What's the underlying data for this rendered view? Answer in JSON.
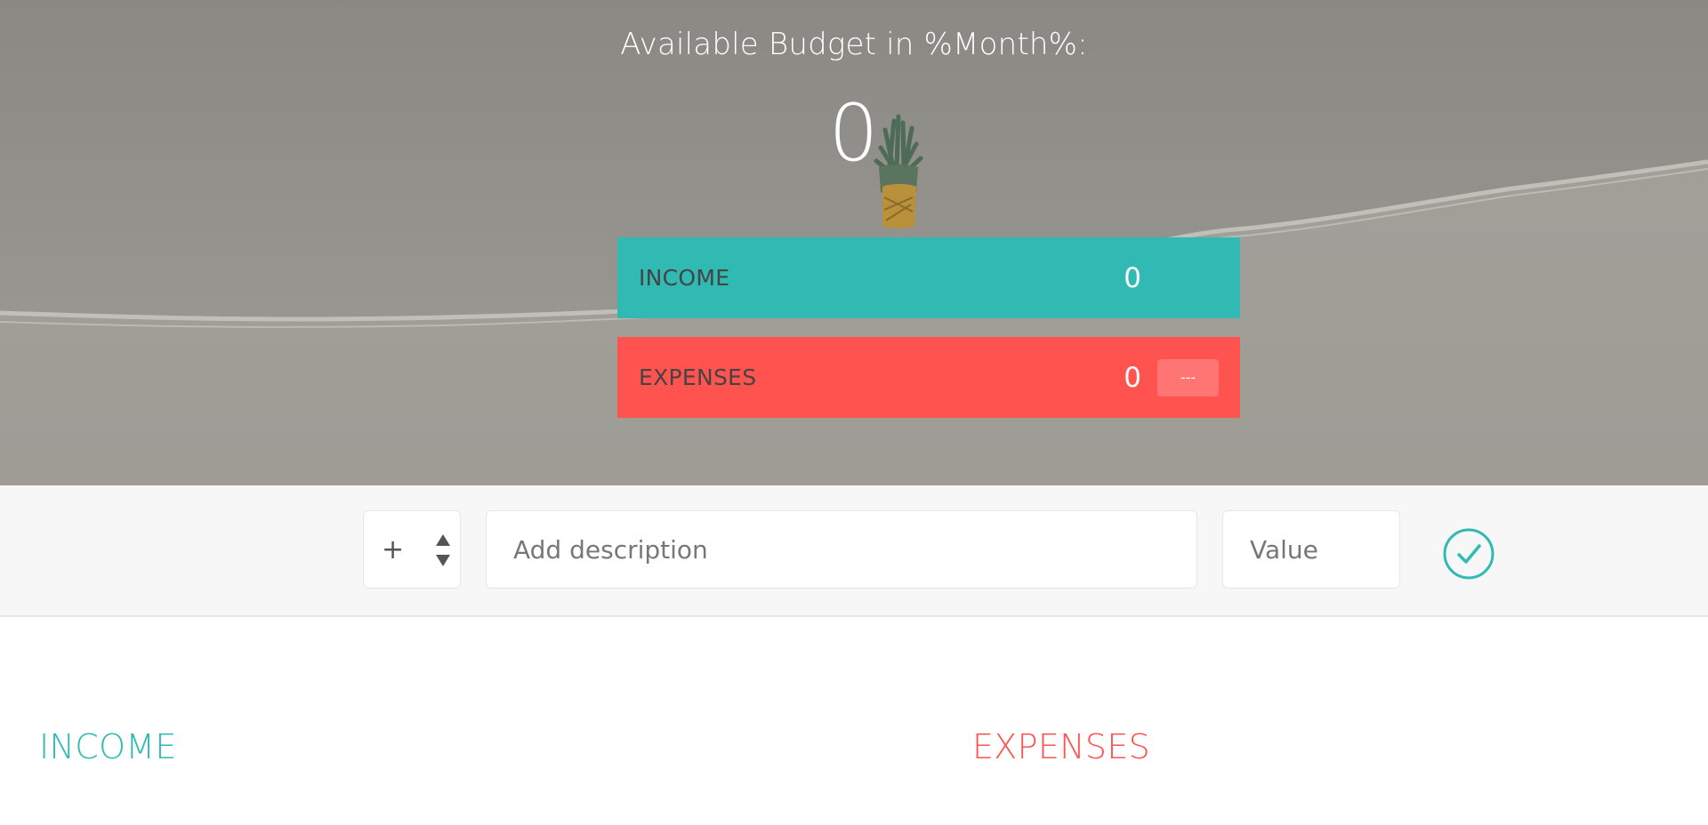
{
  "budget": {
    "title": "Available Budget in %Month%:",
    "value": "0"
  },
  "summary": {
    "income": {
      "label": "INCOME",
      "value": "0"
    },
    "expenses": {
      "label": "EXPENSES",
      "value": "0",
      "percentage": "---"
    }
  },
  "add": {
    "type_value": "+",
    "description_placeholder": "Add description",
    "value_placeholder": "Value",
    "submit_icon": "check-circle-icon"
  },
  "lists": {
    "income_title": "INCOME",
    "expenses_title": "EXPENSES"
  },
  "colors": {
    "income": "#31b9b4",
    "expenses": "#ff5350"
  }
}
